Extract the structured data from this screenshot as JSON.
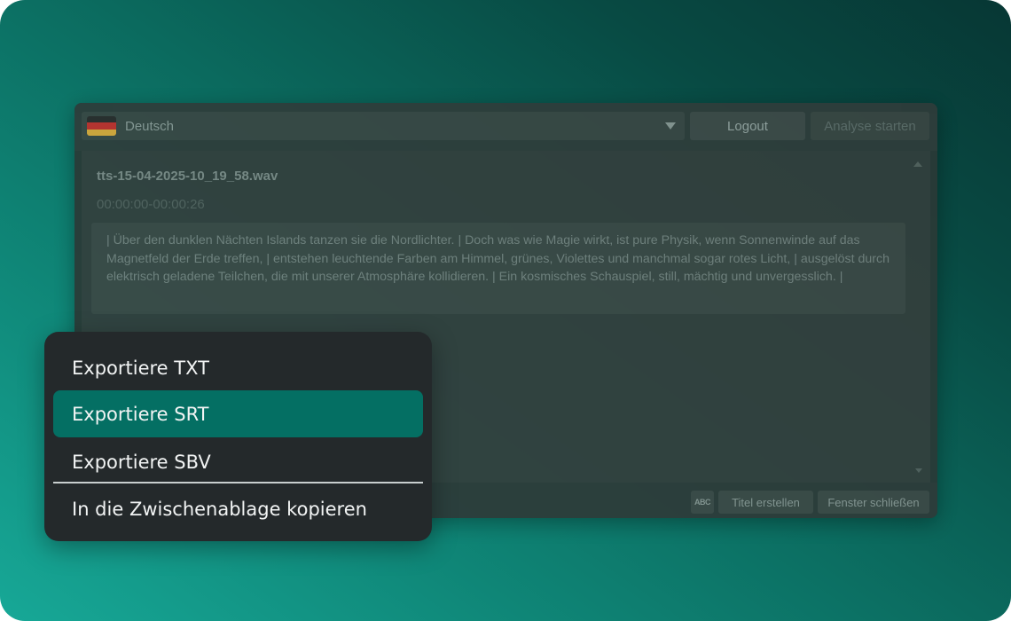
{
  "app": {
    "language": {
      "label": "Deutsch",
      "flag_colors": [
        "#2b2b2b",
        "#c0302c",
        "#d9a93a"
      ],
      "flag_icon": "flag-germany-icon"
    },
    "toolbar": {
      "logout_label": "Logout",
      "analyse_label": "Analyse starten"
    },
    "file": {
      "name": "tts-15-04-2025-10_19_58.wav",
      "timecode": "00:00:00-00:00:26",
      "transcript": "| Über den dunklen Nächten Islands tanzen sie die Nordlichter.  | Doch was wie Magie wirkt, ist pure Physik, wenn Sonnenwinde auf das Magnetfeld der Erde treffen, | entstehen leuchtende Farben am Himmel, grünes, Violettes und manchmal sogar rotes Licht, | ausgelöst durch elektrisch geladene Teilchen, die mit unserer Atmosphäre kollidieren. | Ein kosmisches Schauspiel, still, mächtig und unvergesslich. |"
    },
    "status_bar": {
      "spellcheck_label": "ABC",
      "create_title_label": "Titel erstellen",
      "close_window_label": "Fenster schließen"
    }
  },
  "context_menu": {
    "items": [
      {
        "label": "Exportiere TXT",
        "active": false
      },
      {
        "label": "Exportiere SRT",
        "active": true
      },
      {
        "label": "Exportiere SBV",
        "active": false
      },
      {
        "label": "In die Zwischenablage kopieren",
        "active": false
      }
    ],
    "active_color": "#046f63"
  }
}
